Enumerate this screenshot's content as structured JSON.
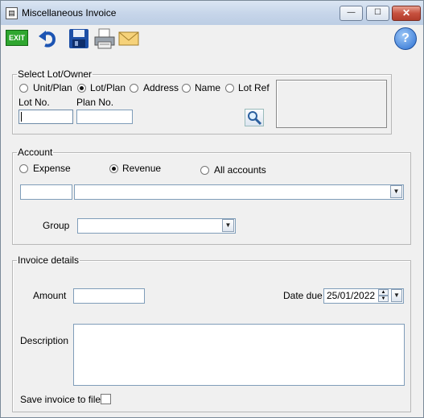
{
  "window": {
    "title": "Miscellaneous Invoice"
  },
  "toolbar": {
    "exit_label": "EXIT",
    "help_label": "?",
    "undo_icon": "undo-icon",
    "save_icon": "save-icon",
    "print_icon": "print-icon",
    "email_icon": "email-icon"
  },
  "select_owner": {
    "legend": "Select Lot/Owner",
    "options": [
      "Unit/Plan",
      "Lot/Plan",
      "Address",
      "Name",
      "Lot Ref"
    ],
    "selected": "Lot/Plan",
    "lot_no_label": "Lot No.",
    "plan_no_label": "Plan No.",
    "lot_no_value": "",
    "plan_no_value": ""
  },
  "account": {
    "legend": "Account",
    "options": [
      "Expense",
      "Revenue",
      "All accounts"
    ],
    "selected": "Revenue",
    "group_label": "Group",
    "code_value": "",
    "account_value": "",
    "group_value": ""
  },
  "invoice": {
    "legend": "Invoice details",
    "amount_label": "Amount",
    "amount_value": "",
    "date_due_label": "Date due",
    "date_due_value": "25/01/2022",
    "description_label": "Description",
    "description_value": "",
    "save_label": "Save invoice to file"
  }
}
